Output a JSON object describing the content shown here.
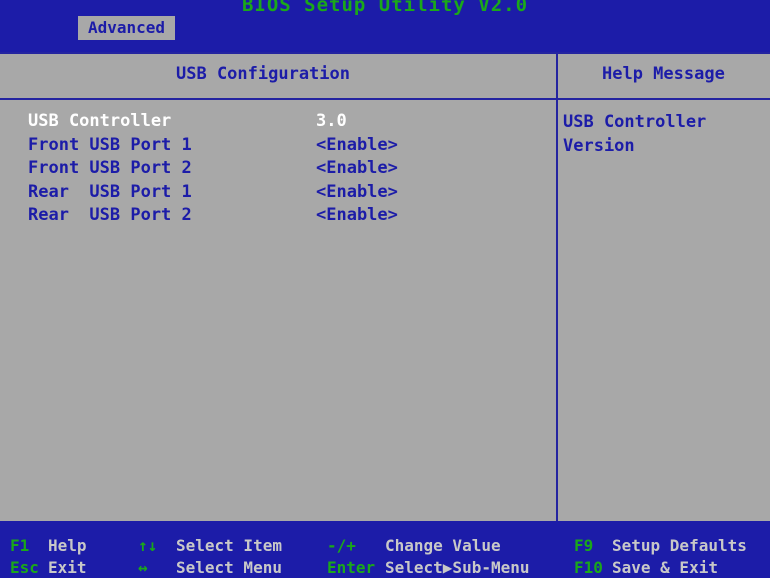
{
  "header": {
    "title": "BIOS Setup Utility V2.0",
    "tab": "Advanced"
  },
  "main": {
    "heading": "USB Configuration",
    "items": [
      {
        "label": "USB Controller",
        "value": "3.0",
        "selected": true
      },
      {
        "label": "Front USB Port 1",
        "value": "<Enable>",
        "selected": false
      },
      {
        "label": "Front USB Port 2",
        "value": "<Enable>",
        "selected": false
      },
      {
        "label": "Rear  USB Port 1",
        "value": "<Enable>",
        "selected": false
      },
      {
        "label": "Rear  USB Port 2",
        "value": "<Enable>",
        "selected": false
      }
    ]
  },
  "help": {
    "heading": "Help Message",
    "text_line1": "USB Controller",
    "text_line2": "Version"
  },
  "footer": {
    "f1_key": "F1",
    "f1_desc": "Help",
    "esc_key": "Esc",
    "esc_desc": "Exit",
    "updown_key": "↑↓",
    "updown_desc": "Select Item",
    "leftright_key": "↔",
    "leftright_desc": "Select Menu",
    "change_key": "-/+",
    "change_desc": "Change Value",
    "enter_key": "Enter",
    "enter_desc": "Select▶Sub-Menu",
    "f9_key": "F9",
    "f9_desc": "Setup Defaults",
    "f10_key": "F10",
    "f10_desc": "Save & Exit"
  }
}
